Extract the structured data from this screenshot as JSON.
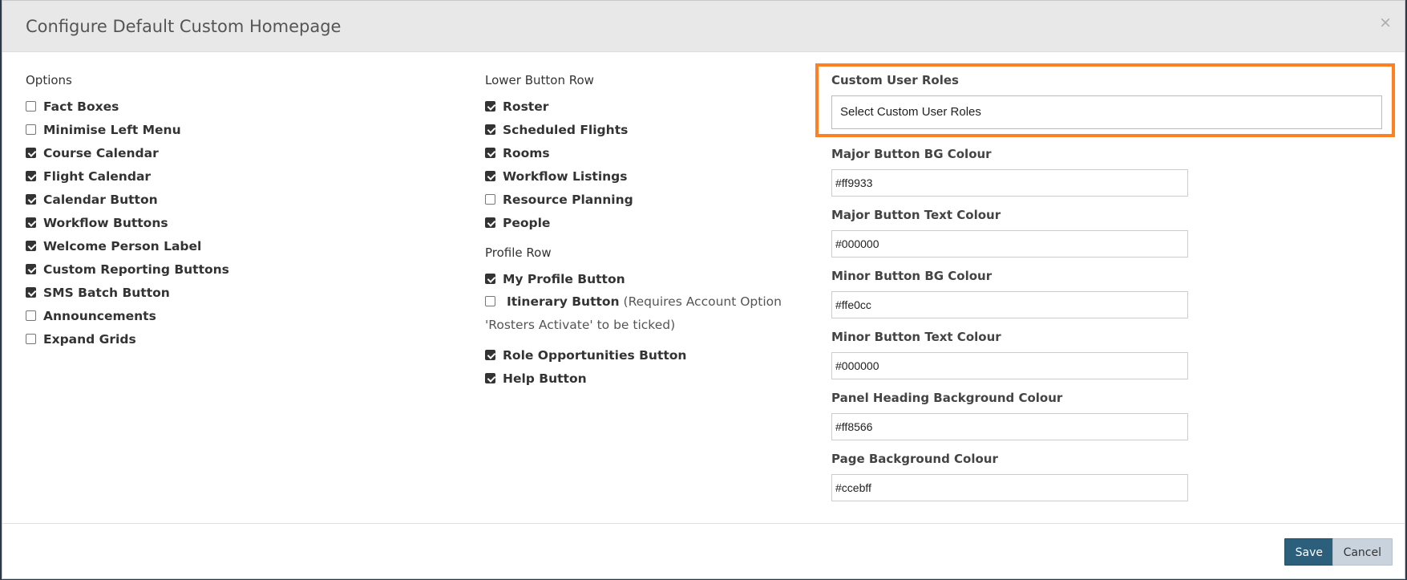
{
  "modal": {
    "title": "Configure Default Custom Homepage",
    "close_glyph": "×"
  },
  "options": {
    "heading": "Options",
    "items": [
      {
        "label": "Fact Boxes",
        "checked": false
      },
      {
        "label": "Minimise Left Menu",
        "checked": false
      },
      {
        "label": "Course Calendar",
        "checked": true
      },
      {
        "label": "Flight Calendar",
        "checked": true
      },
      {
        "label": "Calendar Button",
        "checked": true
      },
      {
        "label": "Workflow Buttons",
        "checked": true
      },
      {
        "label": "Welcome Person Label",
        "checked": true
      },
      {
        "label": "Custom Reporting Buttons",
        "checked": true
      },
      {
        "label": "SMS Batch Button",
        "checked": true
      },
      {
        "label": "Announcements",
        "checked": false
      },
      {
        "label": "Expand Grids",
        "checked": false
      }
    ]
  },
  "lower_button_row": {
    "heading": "Lower Button Row",
    "items": [
      {
        "label": "Roster",
        "checked": true
      },
      {
        "label": "Scheduled Flights",
        "checked": true
      },
      {
        "label": "Rooms",
        "checked": true
      },
      {
        "label": "Workflow Listings",
        "checked": true
      },
      {
        "label": "Resource Planning",
        "checked": false
      },
      {
        "label": "People",
        "checked": true
      }
    ]
  },
  "profile_row": {
    "heading": "Profile Row",
    "my_profile": {
      "label": "My Profile Button",
      "checked": true
    },
    "itinerary": {
      "label": "Itinerary Button",
      "note": "(Requires Account Option 'Rosters Activate' to be ticked)",
      "checked": false
    },
    "more": [
      {
        "label": "Role Opportunities Button",
        "checked": true
      },
      {
        "label": "Help Button",
        "checked": true
      }
    ]
  },
  "custom_user_roles": {
    "label": "Custom User Roles",
    "placeholder": "Select Custom User Roles",
    "highlight_color": "#ff7f23"
  },
  "colours": [
    {
      "label": "Major Button BG Colour",
      "value": "#ff9933"
    },
    {
      "label": "Major Button Text Colour",
      "value": "#000000"
    },
    {
      "label": "Minor Button BG Colour",
      "value": "#ffe0cc"
    },
    {
      "label": "Minor Button Text Colour",
      "value": "#000000"
    },
    {
      "label": "Panel Heading Background Colour",
      "value": "#ff8566"
    },
    {
      "label": "Page Background Colour",
      "value": "#ccebff"
    }
  ],
  "footer": {
    "save_label": "Save",
    "cancel_label": "Cancel"
  }
}
